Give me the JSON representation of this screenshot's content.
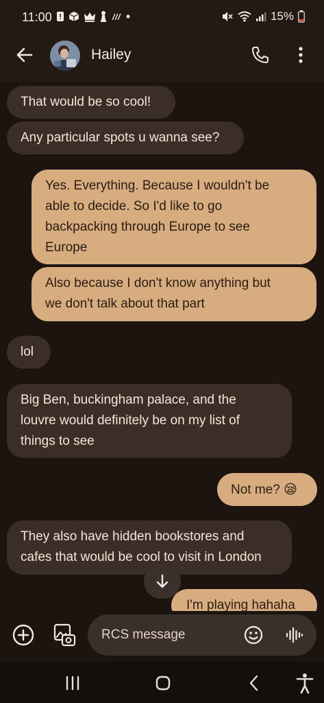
{
  "status_bar": {
    "time": "11:00",
    "battery": "15%",
    "notification_icons": [
      "alert-icon",
      "package-icon",
      "crown-icon",
      "chess-icon",
      "signal-wave-icon",
      "dot-icon"
    ],
    "right_icons": [
      "mute-icon",
      "wifi-icon",
      "cellular-icon",
      "battery-icon"
    ]
  },
  "header": {
    "contact_name": "Hailey",
    "back_icon": "arrow-back-icon",
    "call_icon": "phone-icon",
    "more_icon": "more-vert-icon"
  },
  "messages": [
    {
      "direction": "in",
      "text": "That would be so cool!"
    },
    {
      "direction": "in",
      "text": "Any particular spots u wanna see?"
    },
    {
      "direction": "out",
      "lines": [
        "Yes. Everything. Because I wouldn't be",
        "able to decide. So I'd like to go",
        "backpacking through Europe to see",
        "Europe"
      ]
    },
    {
      "direction": "out",
      "lines": [
        "Also because I don't know anything but",
        "we don't talk about that part"
      ]
    },
    {
      "direction": "in",
      "text": "lol"
    },
    {
      "direction": "in",
      "lines": [
        "Big Ben, buckingham palace, and the",
        "louvre would definitely be on my list of",
        "things to see"
      ]
    },
    {
      "direction": "out",
      "text": "Not me?",
      "emoji": "😪"
    },
    {
      "direction": "in",
      "lines": [
        "They also have hidden bookstores and",
        "cafes that would be cool to visit in London"
      ]
    },
    {
      "direction": "out",
      "text": "I'm playing hahaha"
    }
  ],
  "composer": {
    "placeholder": "RCS message",
    "add_icon": "add-circle-icon",
    "gallery_icon": "gallery-icon",
    "emoji_icon": "emoji-icon",
    "voice_icon": "voice-waveform-icon"
  },
  "scroll_button": {
    "icon": "arrow-down-icon"
  },
  "nav_bar": {
    "icons": [
      "recents-icon",
      "home-icon",
      "back-icon",
      "accessibility-icon"
    ]
  },
  "colors": {
    "background": "#1c140f",
    "incoming_bubble": "#3a2e27",
    "outgoing_bubble": "#d7ac7f",
    "outgoing_text": "#2b1c12"
  }
}
